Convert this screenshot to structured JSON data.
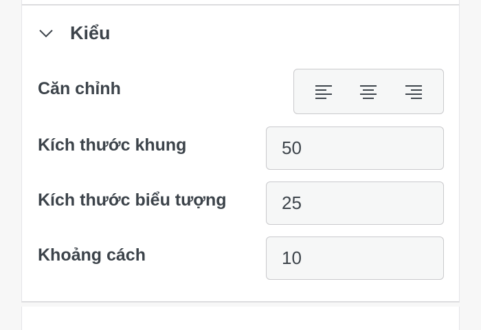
{
  "section": {
    "title": "Kiểu",
    "chevron_icon": "chevron-down-icon"
  },
  "alignment": {
    "label": "Căn chỉnh",
    "options": [
      {
        "icon": "align-left-icon"
      },
      {
        "icon": "align-center-icon"
      },
      {
        "icon": "align-right-icon"
      }
    ]
  },
  "fields": {
    "frame_size": {
      "label": "Kích thước khung",
      "value": "50"
    },
    "icon_size": {
      "label": "Kích thước biểu tượng",
      "value": "25"
    },
    "spacing": {
      "label": "Khoảng cách",
      "value": "10"
    }
  },
  "colors": {
    "text": "#3c434a",
    "input_background": "#f6f7f7",
    "border": "#c9c9cc"
  }
}
